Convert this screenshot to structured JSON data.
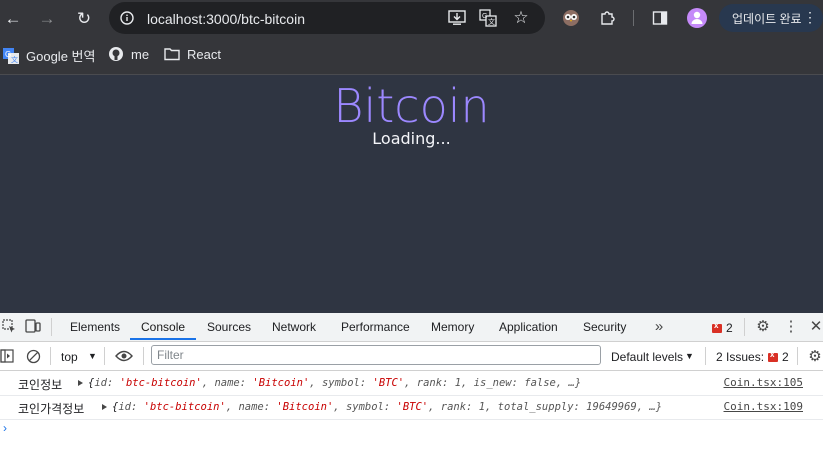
{
  "browser": {
    "url": "localhost:3000/btc-bitcoin",
    "update_button": "업데이트 완료",
    "bookmarks": [
      {
        "label": "Google 번역",
        "icon": "google-translate-icon"
      },
      {
        "label": "me",
        "icon": "github-icon"
      },
      {
        "label": "React",
        "icon": "folder-icon"
      }
    ]
  },
  "page": {
    "title": "Bitcoin",
    "status": "Loading..."
  },
  "devtools": {
    "tabs": [
      "Elements",
      "Console",
      "Sources",
      "Network",
      "Performance",
      "Memory",
      "Application",
      "Security"
    ],
    "active_tab": "Console",
    "error_count": "2",
    "context": "top",
    "filter_placeholder": "Filter",
    "levels": "Default levels",
    "issues_label": "2 Issues:",
    "issues_count": "2"
  },
  "console": {
    "logs": [
      {
        "label": "코인정보",
        "source": "Coin.tsx:105",
        "object": {
          "open": "{",
          "id_key": "id: ",
          "id_val": "'btc-bitcoin'",
          "name_key": ", name: ",
          "name_val": "'Bitcoin'",
          "symbol_key": ", symbol: ",
          "symbol_val": "'BTC'",
          "rank": ", rank: 1",
          "tail": ", is_new: false, …}"
        }
      },
      {
        "label": "코인가격정보",
        "source": "Coin.tsx:109",
        "object": {
          "open": "{",
          "id_key": "id: ",
          "id_val": "'btc-bitcoin'",
          "name_key": ", name: ",
          "name_val": "'Bitcoin'",
          "symbol_key": ", symbol: ",
          "symbol_val": "'BTC'",
          "rank": ", rank: 1",
          "tail": ", total_supply: 19649969, …}"
        }
      }
    ],
    "prompt": "›"
  },
  "colors": {
    "page_bg": "#2f3542",
    "title": "#9c88ff",
    "accent": "#1a73e8",
    "error": "#d93025"
  }
}
